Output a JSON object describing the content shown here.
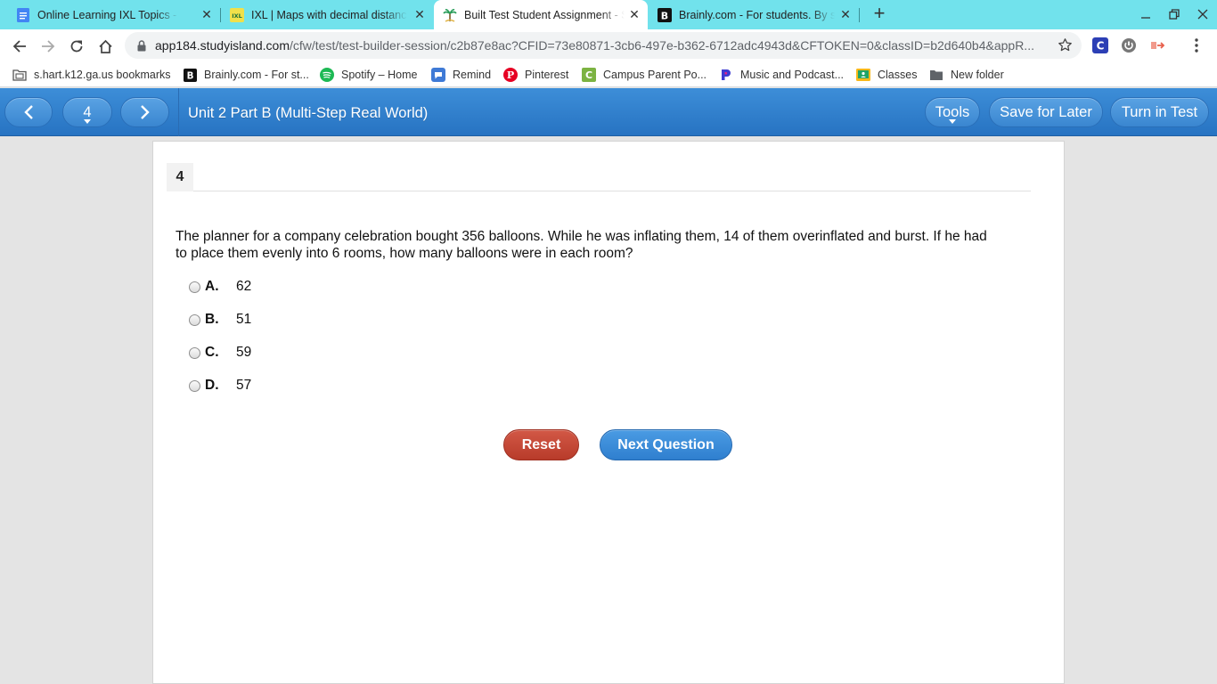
{
  "browser": {
    "tabs": [
      {
        "title": "Online Learning IXL Topics - Goo",
        "icon": "google-docs-icon",
        "active": false
      },
      {
        "title": "IXL | Maps with decimal distance",
        "icon": "ixl-icon",
        "active": false
      },
      {
        "title": "Built Test Student Assignment - S",
        "icon": "study-island-icon",
        "active": true
      },
      {
        "title": "Brainly.com - For students. By st",
        "icon": "brainly-icon",
        "active": false
      }
    ],
    "url_host": "app184.studyisland.com",
    "url_path": "/cfw/test/test-builder-session/c2b87e8ac?CFID=73e80871-3cb6-497e-b362-6712adc4943d&CFTOKEN=0&classID=b2d640b4&appR...",
    "bookmarks": [
      {
        "label": "s.hart.k12.ga.us bookmarks",
        "icon": "bookmarks-folder-icon"
      },
      {
        "label": "Brainly.com - For st...",
        "icon": "brainly-icon"
      },
      {
        "label": "Spotify – Home",
        "icon": "spotify-icon"
      },
      {
        "label": "Remind",
        "icon": "remind-icon"
      },
      {
        "label": "Pinterest",
        "icon": "pinterest-icon"
      },
      {
        "label": "Campus Parent Po...",
        "icon": "campus-icon"
      },
      {
        "label": "Music and Podcast...",
        "icon": "pandora-icon"
      },
      {
        "label": "Classes",
        "icon": "classroom-icon"
      },
      {
        "label": "New folder",
        "icon": "folder-icon"
      }
    ]
  },
  "header": {
    "question_selector": "4",
    "assignment_title": "Unit 2 Part B (Multi-Step Real World)",
    "tools_label": "Tools",
    "save_label": "Save for Later",
    "turn_in_label": "Turn in Test"
  },
  "question": {
    "number": "4",
    "text": "The planner for a company celebration bought 356 balloons. While he was inflating them, 14 of them overinflated and burst. If he had to place them evenly into 6 rooms, how many balloons were in each room?",
    "choices": [
      {
        "letter": "A.",
        "value": "62"
      },
      {
        "letter": "B.",
        "value": "51"
      },
      {
        "letter": "C.",
        "value": "59"
      },
      {
        "letter": "D.",
        "value": "57"
      }
    ]
  },
  "actions": {
    "reset_label": "Reset",
    "next_label": "Next Question"
  },
  "colors": {
    "tab_strip": "#71e2ec",
    "header_blue": "#2f7fcf",
    "reset_red": "#c4473a",
    "next_blue": "#3a8cdb"
  }
}
